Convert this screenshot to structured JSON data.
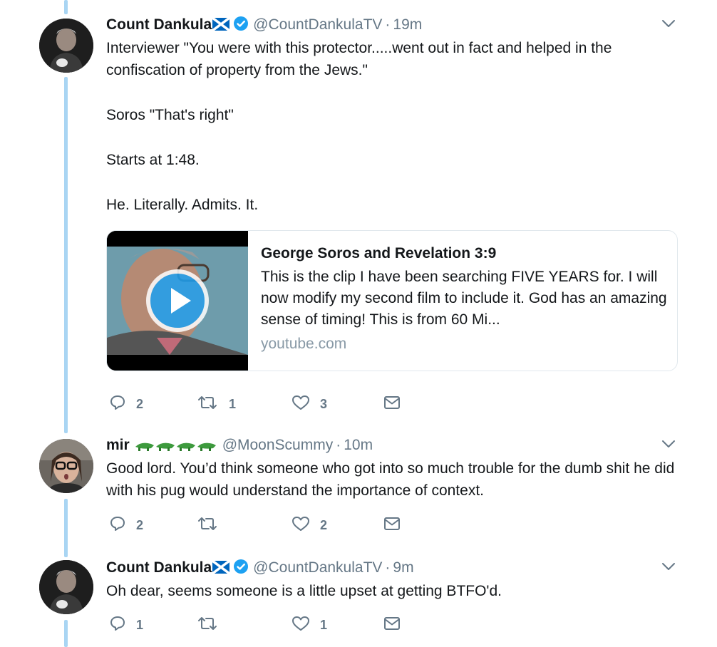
{
  "tweets": [
    {
      "name": "Count Dankula",
      "handle": "@CountDankulaTV",
      "time": "19m",
      "paragraphs": [
        "Interviewer \"You were with this protector.....went out in fact and helped in the confiscation of property from the Jews.\"",
        "Soros \"That's right\"",
        "Starts at 1:48.",
        "He. Literally. Admits. It."
      ],
      "card": {
        "title": "George Soros and Revelation 3:9",
        "description": "This is the clip I have been searching FIVE YEARS for. I will now modify my second film to include it. God has an amazing sense of timing! This is from 60 Mi...",
        "domain": "youtube.com"
      },
      "replies": "2",
      "retweets": "1",
      "likes": "3"
    },
    {
      "name": "mir",
      "handle": "@MoonScummy",
      "time": "10m",
      "paragraphs": [
        "Good lord. You’d think someone who got into so much trouble for the dumb shit he did with his pug would understand the importance of context."
      ],
      "replies": "2",
      "retweets": "",
      "likes": "2"
    },
    {
      "name": "Count Dankula",
      "handle": "@CountDankulaTV",
      "time": "9m",
      "paragraphs": [
        "Oh dear, seems someone is a little upset at getting BTFO'd."
      ],
      "replies": "1",
      "retweets": "",
      "likes": "1"
    }
  ],
  "separator": "·",
  "icons": {
    "reply": "reply-icon",
    "retweet": "retweet-icon",
    "like": "heart-icon",
    "dm": "envelope-icon",
    "more": "chevron-down-icon",
    "verified": "verified-badge-icon",
    "flag": "scotland-flag-icon",
    "crocodiles": "crocodile-emoji-icon",
    "play": "play-icon"
  },
  "colors": {
    "thread_line": "#a9d5f3",
    "verified": "#1da1f2",
    "muted": "#657786",
    "domain": "#8899a6"
  }
}
